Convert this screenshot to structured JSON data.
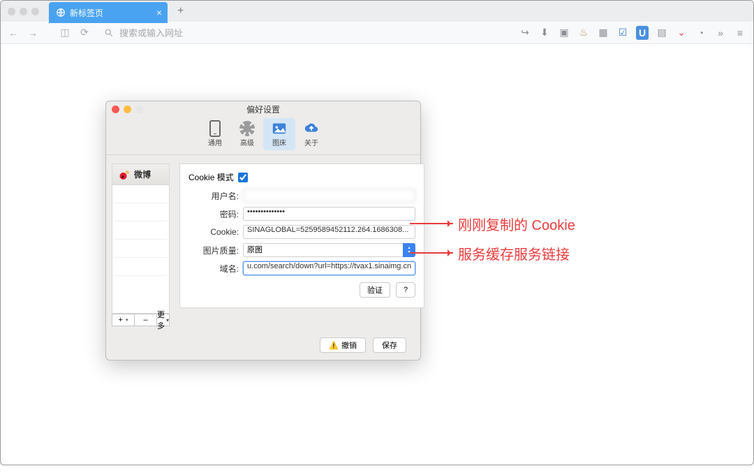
{
  "browser": {
    "tab_title": "新标签页",
    "new_tab_plus": "+",
    "url_placeholder": "搜索或输入网址"
  },
  "prefs": {
    "title": "偏好设置",
    "toolbar": {
      "general": "通用",
      "advanced": "高级",
      "imagebed": "图床",
      "about": "关于"
    },
    "sidebar": {
      "weibo": "微博",
      "plus": "+",
      "minus": "–",
      "more": "更多"
    },
    "form": {
      "cookie_mode_label": "Cookie 模式",
      "user_label": "用户名:",
      "user_value": " ",
      "pwd_label": "密码:",
      "pwd_value": "••••••••••••••",
      "cookie_label": "Cookie:",
      "cookie_value": "SINAGLOBAL=5259589452112.264.1686308...",
      "quality_label": "图片质量:",
      "quality_value": "原图",
      "domain_label": "域名:",
      "domain_value": "u.com/search/down?url=https://tvax1.sinaimg.cn",
      "verify": "验证",
      "help": "?"
    },
    "footer": {
      "undo": "撤销",
      "save": "保存"
    }
  },
  "annotations": {
    "cookie_note": "刚刚复制的 Cookie",
    "domain_note": "服务缓存服务链接"
  }
}
